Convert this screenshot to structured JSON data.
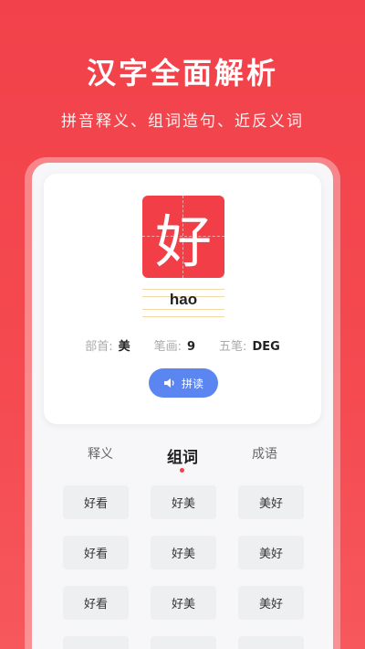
{
  "promo": {
    "title": "汉字全面解析",
    "subtitle": "拼音释义、组词造句、近反义词"
  },
  "character": {
    "glyph": "好",
    "pinyin": "hao",
    "radical_label": "部首:",
    "radical_value": "美",
    "strokes_label": "笔画:",
    "strokes_value": "9",
    "wubi_label": "五笔:",
    "wubi_value": "DEG",
    "read_button": "拼读"
  },
  "tabs": [
    {
      "label": "释义",
      "active": false
    },
    {
      "label": "组词",
      "active": true
    },
    {
      "label": "成语",
      "active": false
    }
  ],
  "words": [
    "好看",
    "好美",
    "美好",
    "好看",
    "好美",
    "美好",
    "好看",
    "好美",
    "美好",
    "",
    "",
    ""
  ],
  "colors": {
    "brand_red": "#f2414a",
    "button_blue": "#5b86f2"
  }
}
